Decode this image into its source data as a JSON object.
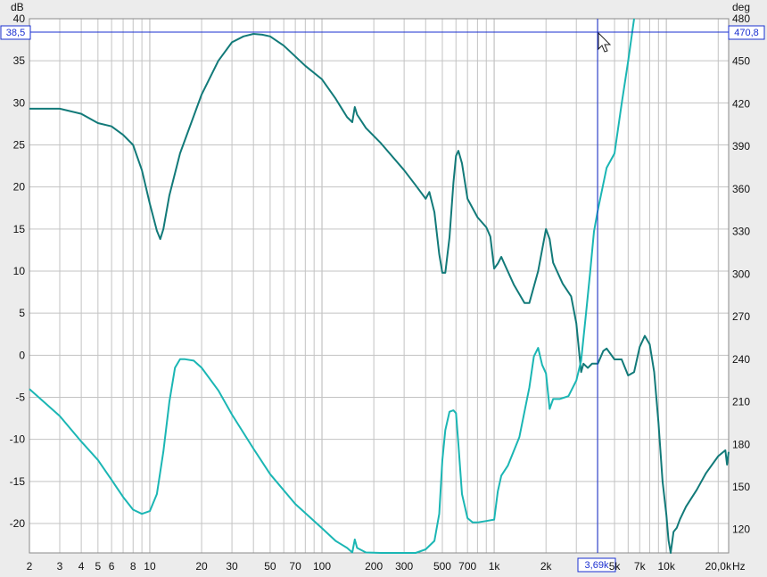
{
  "chart_data": {
    "type": "line",
    "x_scale": "log",
    "x_range_hz": [
      2,
      23000
    ],
    "y_left": {
      "unit": "dB",
      "range": [
        -23.5,
        40
      ],
      "ticks": [
        40,
        35,
        30,
        25,
        20,
        15,
        10,
        5,
        0,
        -5,
        -10,
        -15,
        -20
      ]
    },
    "y_right": {
      "unit": "deg",
      "range": [
        103.5,
        480
      ],
      "ticks": [
        480,
        450,
        420,
        390,
        360,
        330,
        300,
        270,
        240,
        210,
        180,
        150,
        120
      ]
    },
    "x_unit": "Hz",
    "x_ticks": [
      {
        "value": 2,
        "label": "2"
      },
      {
        "value": 3,
        "label": "3"
      },
      {
        "value": 4,
        "label": "4"
      },
      {
        "value": 5,
        "label": "5"
      },
      {
        "value": 6,
        "label": "6"
      },
      {
        "value": 8,
        "label": "8"
      },
      {
        "value": 10,
        "label": "10"
      },
      {
        "value": 20,
        "label": "20"
      },
      {
        "value": 30,
        "label": "30"
      },
      {
        "value": 50,
        "label": "50"
      },
      {
        "value": 70,
        "label": "70"
      },
      {
        "value": 100,
        "label": "100"
      },
      {
        "value": 200,
        "label": "200"
      },
      {
        "value": 300,
        "label": "300"
      },
      {
        "value": 500,
        "label": "500"
      },
      {
        "value": 700,
        "label": "700"
      },
      {
        "value": 1000,
        "label": "1k"
      },
      {
        "value": 2000,
        "label": "2k"
      },
      {
        "value": 5000,
        "label": "5k"
      },
      {
        "value": 7000,
        "label": "7k"
      },
      {
        "value": 10000,
        "label": "10k"
      },
      {
        "value": 20000,
        "label": "20,0k"
      }
    ],
    "grid": true,
    "series": [
      {
        "color": "#127a79",
        "axis": "left",
        "points": [
          [
            2,
            29.3
          ],
          [
            3,
            29.3
          ],
          [
            4,
            28.7
          ],
          [
            5,
            27.6
          ],
          [
            6,
            27.2
          ],
          [
            7,
            26.2
          ],
          [
            8,
            25
          ],
          [
            9,
            22
          ],
          [
            10,
            18
          ],
          [
            11,
            14.8
          ],
          [
            11.5,
            13.8
          ],
          [
            12,
            15
          ],
          [
            13,
            19
          ],
          [
            15,
            24
          ],
          [
            20,
            31
          ],
          [
            25,
            35
          ],
          [
            30,
            37.2
          ],
          [
            35,
            37.9
          ],
          [
            40,
            38.2
          ],
          [
            45,
            38.1
          ],
          [
            50,
            37.9
          ],
          [
            60,
            36.8
          ],
          [
            80,
            34.4
          ],
          [
            100,
            32.8
          ],
          [
            120,
            30.5
          ],
          [
            140,
            28.3
          ],
          [
            150,
            27.7
          ],
          [
            155,
            29.5
          ],
          [
            160,
            28.6
          ],
          [
            180,
            27
          ],
          [
            220,
            25.2
          ],
          [
            300,
            22
          ],
          [
            350,
            20.2
          ],
          [
            400,
            18.6
          ],
          [
            420,
            19.4
          ],
          [
            450,
            17
          ],
          [
            480,
            12
          ],
          [
            500,
            9.8
          ],
          [
            520,
            9.8
          ],
          [
            550,
            14
          ],
          [
            580,
            20.5
          ],
          [
            600,
            23.7
          ],
          [
            620,
            24.3
          ],
          [
            650,
            22.8
          ],
          [
            700,
            18.6
          ],
          [
            800,
            16.4
          ],
          [
            900,
            15.2
          ],
          [
            950,
            14.1
          ],
          [
            1000,
            10.3
          ],
          [
            1050,
            10.9
          ],
          [
            1100,
            11.7
          ],
          [
            1150,
            10.8
          ],
          [
            1300,
            8.4
          ],
          [
            1500,
            6.2
          ],
          [
            1600,
            6.2
          ],
          [
            1800,
            10
          ],
          [
            2000,
            15
          ],
          [
            2100,
            13.8
          ],
          [
            2200,
            11
          ],
          [
            2500,
            8.5
          ],
          [
            2800,
            7
          ],
          [
            3000,
            3.8
          ],
          [
            3200,
            -2
          ],
          [
            3300,
            -1
          ],
          [
            3500,
            -1.5
          ],
          [
            3700,
            -1
          ],
          [
            4000,
            -1
          ],
          [
            4300,
            0.5
          ],
          [
            4500,
            0.8
          ],
          [
            5000,
            -0.5
          ],
          [
            5500,
            -0.5
          ],
          [
            6000,
            -2.4
          ],
          [
            6500,
            -2
          ],
          [
            7000,
            1
          ],
          [
            7500,
            2.3
          ],
          [
            8000,
            1.3
          ],
          [
            8500,
            -2
          ],
          [
            9000,
            -8
          ],
          [
            9500,
            -15
          ],
          [
            10000,
            -19
          ],
          [
            10300,
            -22
          ],
          [
            10600,
            -23.5
          ],
          [
            11000,
            -21
          ],
          [
            11500,
            -20.5
          ],
          [
            12000,
            -19.5
          ],
          [
            13000,
            -18
          ],
          [
            15000,
            -16
          ],
          [
            17000,
            -14
          ],
          [
            20000,
            -12
          ],
          [
            22000,
            -11.3
          ],
          [
            22500,
            -13
          ],
          [
            23000,
            -11.5
          ]
        ]
      },
      {
        "color": "#1bb6b4",
        "axis": "right",
        "points": [
          [
            2,
            219
          ],
          [
            3,
            200
          ],
          [
            4,
            182
          ],
          [
            5,
            169
          ],
          [
            6,
            155
          ],
          [
            7,
            143
          ],
          [
            8,
            134
          ],
          [
            9,
            131
          ],
          [
            10,
            133
          ],
          [
            11,
            145
          ],
          [
            12,
            175
          ],
          [
            13,
            210
          ],
          [
            14,
            234
          ],
          [
            15,
            240
          ],
          [
            16,
            240
          ],
          [
            18,
            239
          ],
          [
            20,
            234
          ],
          [
            25,
            218
          ],
          [
            30,
            201
          ],
          [
            40,
            177
          ],
          [
            50,
            159
          ],
          [
            70,
            138
          ],
          [
            100,
            121
          ],
          [
            120,
            112
          ],
          [
            140,
            107
          ],
          [
            150,
            103.8
          ],
          [
            155,
            113
          ],
          [
            160,
            107
          ],
          [
            180,
            103.8
          ],
          [
            220,
            102.8
          ],
          [
            300,
            102
          ],
          [
            350,
            103
          ],
          [
            400,
            106
          ],
          [
            450,
            112
          ],
          [
            480,
            131
          ],
          [
            500,
            169
          ],
          [
            520,
            190
          ],
          [
            550,
            203
          ],
          [
            580,
            204
          ],
          [
            600,
            202
          ],
          [
            620,
            180
          ],
          [
            650,
            145
          ],
          [
            700,
            128
          ],
          [
            750,
            125
          ],
          [
            800,
            125
          ],
          [
            900,
            126
          ],
          [
            1000,
            127
          ],
          [
            1050,
            147
          ],
          [
            1100,
            158
          ],
          [
            1200,
            165
          ],
          [
            1400,
            185
          ],
          [
            1600,
            220
          ],
          [
            1700,
            242
          ],
          [
            1800,
            248
          ],
          [
            1900,
            236
          ],
          [
            2000,
            230
          ],
          [
            2100,
            205
          ],
          [
            2200,
            212
          ],
          [
            2400,
            212
          ],
          [
            2700,
            214
          ],
          [
            3000,
            225
          ],
          [
            3200,
            239
          ],
          [
            3400,
            270
          ],
          [
            3600,
            300
          ],
          [
            3800,
            330
          ],
          [
            4000,
            345
          ],
          [
            4500,
            375
          ],
          [
            5000,
            385
          ],
          [
            5500,
            420
          ],
          [
            6000,
            450
          ],
          [
            6500,
            480
          ]
        ]
      }
    ],
    "cursor": {
      "x_readout": "3,69k",
      "y_left_readout": "38,5",
      "y_right_readout": "470,8"
    },
    "colors": {
      "background": "#ffffff",
      "grid": "#c3c3c3",
      "cursor": "#1a2fd0"
    }
  }
}
